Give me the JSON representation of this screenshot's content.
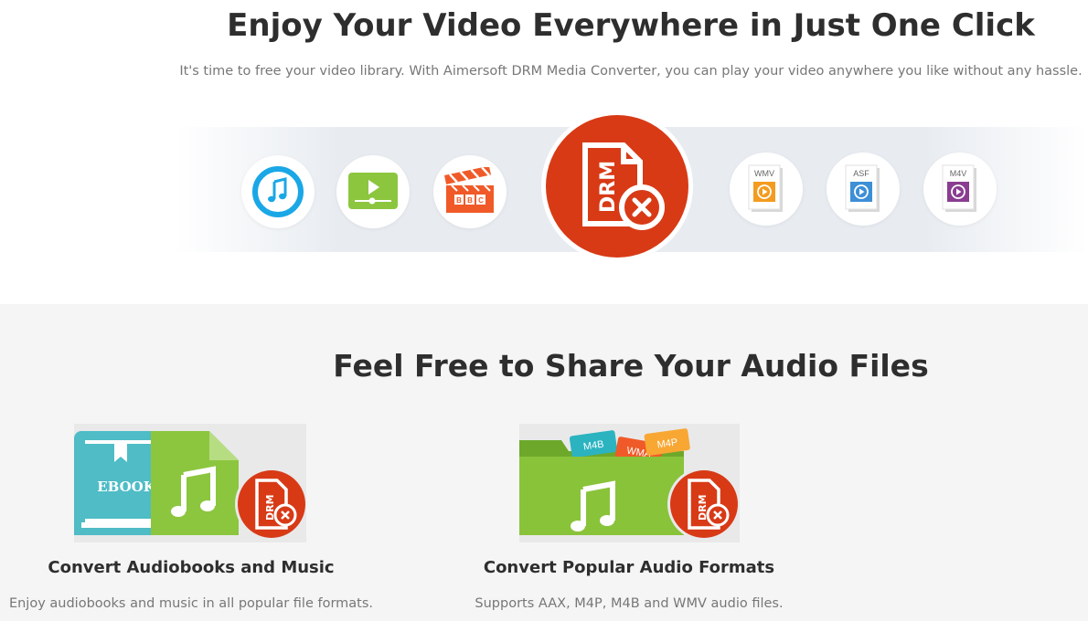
{
  "hero": {
    "title": "Enjoy Your Video Everywhere in Just One Click",
    "subtitle": "It's time to free your video library. With Aimersoft DRM Media Converter, you can play your video anywhere you like without any hassle."
  },
  "strip": {
    "icons": [
      "itunes-icon",
      "video-player-icon",
      "bbc-clapper-icon",
      "drm-remove-icon",
      "wmv-file-icon",
      "asf-file-icon",
      "m4v-file-icon"
    ],
    "drm_label": "DRM",
    "file_formats": [
      "WMV",
      "ASF",
      "M4V"
    ],
    "clapper_label": "BBC"
  },
  "audio_section": {
    "title": "Feel Free to Share Your Audio Files",
    "features": [
      {
        "title": "Convert Audiobooks and Music",
        "description": "Enjoy audiobooks and music in all popular file formats.",
        "image_label": "EBOOK",
        "drm_label": "DRM"
      },
      {
        "title": "Convert Popular Audio Formats",
        "description": "Supports AAX, M4P, M4B and WMV audio files.",
        "tags": [
          "M4B",
          "WMA",
          "M4P"
        ],
        "drm_label": "DRM"
      }
    ]
  },
  "colors": {
    "drm_red": "#d83a16",
    "itunes_blue": "#1aa7e6",
    "player_green": "#8cc63f",
    "clapper_orange": "#f05a28",
    "wmv_orange": "#f39c1f",
    "asf_blue": "#3d8fd6",
    "m4v_purple": "#8a3d91",
    "ebook_teal": "#4fbcc6",
    "folder_green": "#89c33a"
  }
}
